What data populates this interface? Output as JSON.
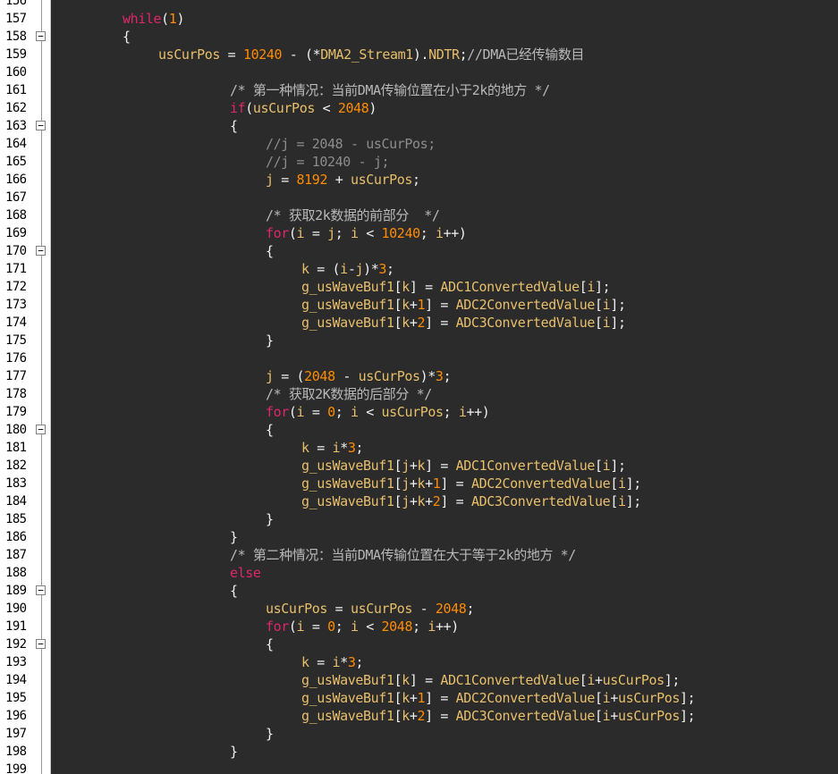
{
  "colors": {
    "background": "#2b2b2b",
    "gutter": "#ffffff",
    "line_number": "#000000",
    "plain": "#e8bf6a",
    "keyword": "#e0266a",
    "number": "#ff8c00",
    "punct": "#f0f0f0",
    "comment": "#b8b8b8",
    "disabled": "#8c8c8c"
  },
  "lines": [
    {
      "num": "156",
      "indent": 0,
      "fold": "line",
      "tokens": []
    },
    {
      "num": "157",
      "indent": 1,
      "fold": "line",
      "tokens": [
        [
          "keyword",
          "while"
        ],
        [
          "punct",
          "("
        ],
        [
          "number",
          "1"
        ],
        [
          "punct",
          ")"
        ]
      ]
    },
    {
      "num": "158",
      "indent": 1,
      "fold": "box",
      "tokens": [
        [
          "punct",
          "{"
        ]
      ]
    },
    {
      "num": "159",
      "indent": 2,
      "fold": "line",
      "tokens": [
        [
          "plain",
          "usCurPos"
        ],
        [
          "punct",
          " = "
        ],
        [
          "number",
          "10240"
        ],
        [
          "punct",
          " - ("
        ],
        [
          "punct",
          "*"
        ],
        [
          "plain",
          "DMA2_Stream1"
        ],
        [
          "punct",
          ")."
        ],
        [
          "plain",
          "NDTR"
        ],
        [
          "punct",
          ";"
        ],
        [
          "comment",
          "//DMA已经传输数目"
        ]
      ]
    },
    {
      "num": "160",
      "indent": 0,
      "fold": "line",
      "tokens": []
    },
    {
      "num": "161",
      "indent": 4,
      "fold": "line",
      "tokens": [
        [
          "comment",
          "/* 第一种情况：当前DMA传输位置在小于2k的地方 */"
        ]
      ]
    },
    {
      "num": "162",
      "indent": 4,
      "fold": "line",
      "tokens": [
        [
          "keyword",
          "if"
        ],
        [
          "punct",
          "("
        ],
        [
          "plain",
          "usCurPos"
        ],
        [
          "punct",
          " < "
        ],
        [
          "number",
          "2048"
        ],
        [
          "punct",
          ")"
        ]
      ]
    },
    {
      "num": "163",
      "indent": 4,
      "fold": "box",
      "tokens": [
        [
          "punct",
          "{"
        ]
      ]
    },
    {
      "num": "164",
      "indent": 5,
      "fold": "line",
      "tokens": [
        [
          "disabled",
          "//j = 2048 - usCurPos;"
        ]
      ]
    },
    {
      "num": "165",
      "indent": 5,
      "fold": "line",
      "tokens": [
        [
          "disabled",
          "//j = 10240 - j;"
        ]
      ]
    },
    {
      "num": "166",
      "indent": 5,
      "fold": "line",
      "tokens": [
        [
          "plain",
          "j"
        ],
        [
          "punct",
          " = "
        ],
        [
          "number",
          "8192"
        ],
        [
          "punct",
          " + "
        ],
        [
          "plain",
          "usCurPos"
        ],
        [
          "punct",
          ";"
        ]
      ]
    },
    {
      "num": "167",
      "indent": 0,
      "fold": "line",
      "tokens": []
    },
    {
      "num": "168",
      "indent": 5,
      "fold": "line",
      "tokens": [
        [
          "comment",
          "/* 获取2k数据的前部分  */"
        ]
      ]
    },
    {
      "num": "169",
      "indent": 5,
      "fold": "line",
      "tokens": [
        [
          "keyword",
          "for"
        ],
        [
          "punct",
          "("
        ],
        [
          "plain",
          "i"
        ],
        [
          "punct",
          " = "
        ],
        [
          "plain",
          "j"
        ],
        [
          "punct",
          "; "
        ],
        [
          "plain",
          "i"
        ],
        [
          "punct",
          " < "
        ],
        [
          "number",
          "10240"
        ],
        [
          "punct",
          "; "
        ],
        [
          "plain",
          "i"
        ],
        [
          "punct",
          "++)"
        ]
      ]
    },
    {
      "num": "170",
      "indent": 5,
      "fold": "box",
      "tokens": [
        [
          "punct",
          "{"
        ]
      ]
    },
    {
      "num": "171",
      "indent": 6,
      "fold": "line",
      "tokens": [
        [
          "plain",
          "k"
        ],
        [
          "punct",
          " = ("
        ],
        [
          "plain",
          "i"
        ],
        [
          "punct",
          "-"
        ],
        [
          "plain",
          "j"
        ],
        [
          "punct",
          ")*"
        ],
        [
          "number",
          "3"
        ],
        [
          "punct",
          ";"
        ]
      ]
    },
    {
      "num": "172",
      "indent": 6,
      "fold": "line",
      "tokens": [
        [
          "plain",
          "g_usWaveBuf1"
        ],
        [
          "punct",
          "["
        ],
        [
          "plain",
          "k"
        ],
        [
          "punct",
          "] = "
        ],
        [
          "plain",
          "ADC1ConvertedValue"
        ],
        [
          "punct",
          "["
        ],
        [
          "plain",
          "i"
        ],
        [
          "punct",
          "];"
        ]
      ]
    },
    {
      "num": "173",
      "indent": 6,
      "fold": "line",
      "tokens": [
        [
          "plain",
          "g_usWaveBuf1"
        ],
        [
          "punct",
          "["
        ],
        [
          "plain",
          "k"
        ],
        [
          "punct",
          "+"
        ],
        [
          "number",
          "1"
        ],
        [
          "punct",
          "] = "
        ],
        [
          "plain",
          "ADC2ConvertedValue"
        ],
        [
          "punct",
          "["
        ],
        [
          "plain",
          "i"
        ],
        [
          "punct",
          "];"
        ]
      ]
    },
    {
      "num": "174",
      "indent": 6,
      "fold": "line",
      "tokens": [
        [
          "plain",
          "g_usWaveBuf1"
        ],
        [
          "punct",
          "["
        ],
        [
          "plain",
          "k"
        ],
        [
          "punct",
          "+"
        ],
        [
          "number",
          "2"
        ],
        [
          "punct",
          "] = "
        ],
        [
          "plain",
          "ADC3ConvertedValue"
        ],
        [
          "punct",
          "["
        ],
        [
          "plain",
          "i"
        ],
        [
          "punct",
          "];"
        ]
      ]
    },
    {
      "num": "175",
      "indent": 5,
      "fold": "line",
      "tokens": [
        [
          "punct",
          "}"
        ]
      ]
    },
    {
      "num": "176",
      "indent": 0,
      "fold": "line",
      "tokens": []
    },
    {
      "num": "177",
      "indent": 5,
      "fold": "line",
      "tokens": [
        [
          "plain",
          "j"
        ],
        [
          "punct",
          " = ("
        ],
        [
          "number",
          "2048"
        ],
        [
          "punct",
          " - "
        ],
        [
          "plain",
          "usCurPos"
        ],
        [
          "punct",
          ")*"
        ],
        [
          "number",
          "3"
        ],
        [
          "punct",
          ";"
        ]
      ]
    },
    {
      "num": "178",
      "indent": 5,
      "fold": "line",
      "tokens": [
        [
          "comment",
          "/* 获取2K数据的后部分 */"
        ]
      ]
    },
    {
      "num": "179",
      "indent": 5,
      "fold": "line",
      "tokens": [
        [
          "keyword",
          "for"
        ],
        [
          "punct",
          "("
        ],
        [
          "plain",
          "i"
        ],
        [
          "punct",
          " = "
        ],
        [
          "number",
          "0"
        ],
        [
          "punct",
          "; "
        ],
        [
          "plain",
          "i"
        ],
        [
          "punct",
          " < "
        ],
        [
          "plain",
          "usCurPos"
        ],
        [
          "punct",
          "; "
        ],
        [
          "plain",
          "i"
        ],
        [
          "punct",
          "++)"
        ]
      ]
    },
    {
      "num": "180",
      "indent": 5,
      "fold": "box",
      "tokens": [
        [
          "punct",
          "{"
        ]
      ]
    },
    {
      "num": "181",
      "indent": 6,
      "fold": "line",
      "tokens": [
        [
          "plain",
          "k"
        ],
        [
          "punct",
          " = "
        ],
        [
          "plain",
          "i"
        ],
        [
          "punct",
          "*"
        ],
        [
          "number",
          "3"
        ],
        [
          "punct",
          ";"
        ]
      ]
    },
    {
      "num": "182",
      "indent": 6,
      "fold": "line",
      "tokens": [
        [
          "plain",
          "g_usWaveBuf1"
        ],
        [
          "punct",
          "["
        ],
        [
          "plain",
          "j"
        ],
        [
          "punct",
          "+"
        ],
        [
          "plain",
          "k"
        ],
        [
          "punct",
          "] = "
        ],
        [
          "plain",
          "ADC1ConvertedValue"
        ],
        [
          "punct",
          "["
        ],
        [
          "plain",
          "i"
        ],
        [
          "punct",
          "];"
        ]
      ]
    },
    {
      "num": "183",
      "indent": 6,
      "fold": "line",
      "tokens": [
        [
          "plain",
          "g_usWaveBuf1"
        ],
        [
          "punct",
          "["
        ],
        [
          "plain",
          "j"
        ],
        [
          "punct",
          "+"
        ],
        [
          "plain",
          "k"
        ],
        [
          "punct",
          "+"
        ],
        [
          "number",
          "1"
        ],
        [
          "punct",
          "] = "
        ],
        [
          "plain",
          "ADC2ConvertedValue"
        ],
        [
          "punct",
          "["
        ],
        [
          "plain",
          "i"
        ],
        [
          "punct",
          "];"
        ]
      ]
    },
    {
      "num": "184",
      "indent": 6,
      "fold": "line",
      "tokens": [
        [
          "plain",
          "g_usWaveBuf1"
        ],
        [
          "punct",
          "["
        ],
        [
          "plain",
          "j"
        ],
        [
          "punct",
          "+"
        ],
        [
          "plain",
          "k"
        ],
        [
          "punct",
          "+"
        ],
        [
          "number",
          "2"
        ],
        [
          "punct",
          "] = "
        ],
        [
          "plain",
          "ADC3ConvertedValue"
        ],
        [
          "punct",
          "["
        ],
        [
          "plain",
          "i"
        ],
        [
          "punct",
          "];"
        ]
      ]
    },
    {
      "num": "185",
      "indent": 5,
      "fold": "line",
      "tokens": [
        [
          "punct",
          "}"
        ]
      ]
    },
    {
      "num": "186",
      "indent": 4,
      "fold": "line",
      "tokens": [
        [
          "punct",
          "}"
        ]
      ]
    },
    {
      "num": "187",
      "indent": 4,
      "fold": "line",
      "tokens": [
        [
          "comment",
          "/* 第二种情况：当前DMA传输位置在大于等于2k的地方 */"
        ]
      ]
    },
    {
      "num": "188",
      "indent": 4,
      "fold": "line",
      "tokens": [
        [
          "keyword",
          "else"
        ]
      ]
    },
    {
      "num": "189",
      "indent": 4,
      "fold": "box",
      "tokens": [
        [
          "punct",
          "{"
        ]
      ]
    },
    {
      "num": "190",
      "indent": 5,
      "fold": "line",
      "tokens": [
        [
          "plain",
          "usCurPos"
        ],
        [
          "punct",
          " = "
        ],
        [
          "plain",
          "usCurPos"
        ],
        [
          "punct",
          " - "
        ],
        [
          "number",
          "2048"
        ],
        [
          "punct",
          ";"
        ]
      ]
    },
    {
      "num": "191",
      "indent": 5,
      "fold": "line",
      "tokens": [
        [
          "keyword",
          "for"
        ],
        [
          "punct",
          "("
        ],
        [
          "plain",
          "i"
        ],
        [
          "punct",
          " = "
        ],
        [
          "number",
          "0"
        ],
        [
          "punct",
          "; "
        ],
        [
          "plain",
          "i"
        ],
        [
          "punct",
          " < "
        ],
        [
          "number",
          "2048"
        ],
        [
          "punct",
          "; "
        ],
        [
          "plain",
          "i"
        ],
        [
          "punct",
          "++)"
        ]
      ]
    },
    {
      "num": "192",
      "indent": 5,
      "fold": "box",
      "tokens": [
        [
          "punct",
          "{"
        ]
      ]
    },
    {
      "num": "193",
      "indent": 6,
      "fold": "line",
      "tokens": [
        [
          "plain",
          "k"
        ],
        [
          "punct",
          " = "
        ],
        [
          "plain",
          "i"
        ],
        [
          "punct",
          "*"
        ],
        [
          "number",
          "3"
        ],
        [
          "punct",
          ";"
        ]
      ]
    },
    {
      "num": "194",
      "indent": 6,
      "fold": "line",
      "tokens": [
        [
          "plain",
          "g_usWaveBuf1"
        ],
        [
          "punct",
          "["
        ],
        [
          "plain",
          "k"
        ],
        [
          "punct",
          "] = "
        ],
        [
          "plain",
          "ADC1ConvertedValue"
        ],
        [
          "punct",
          "["
        ],
        [
          "plain",
          "i"
        ],
        [
          "punct",
          "+"
        ],
        [
          "plain",
          "usCurPos"
        ],
        [
          "punct",
          "];"
        ]
      ]
    },
    {
      "num": "195",
      "indent": 6,
      "fold": "line",
      "tokens": [
        [
          "plain",
          "g_usWaveBuf1"
        ],
        [
          "punct",
          "["
        ],
        [
          "plain",
          "k"
        ],
        [
          "punct",
          "+"
        ],
        [
          "number",
          "1"
        ],
        [
          "punct",
          "] = "
        ],
        [
          "plain",
          "ADC2ConvertedValue"
        ],
        [
          "punct",
          "["
        ],
        [
          "plain",
          "i"
        ],
        [
          "punct",
          "+"
        ],
        [
          "plain",
          "usCurPos"
        ],
        [
          "punct",
          "];"
        ]
      ]
    },
    {
      "num": "196",
      "indent": 6,
      "fold": "line",
      "tokens": [
        [
          "plain",
          "g_usWaveBuf1"
        ],
        [
          "punct",
          "["
        ],
        [
          "plain",
          "k"
        ],
        [
          "punct",
          "+"
        ],
        [
          "number",
          "2"
        ],
        [
          "punct",
          "] = "
        ],
        [
          "plain",
          "ADC3ConvertedValue"
        ],
        [
          "punct",
          "["
        ],
        [
          "plain",
          "i"
        ],
        [
          "punct",
          "+"
        ],
        [
          "plain",
          "usCurPos"
        ],
        [
          "punct",
          "];"
        ]
      ]
    },
    {
      "num": "197",
      "indent": 5,
      "fold": "line",
      "tokens": [
        [
          "punct",
          "}"
        ]
      ]
    },
    {
      "num": "198",
      "indent": 4,
      "fold": "line",
      "tokens": [
        [
          "punct",
          "}"
        ]
      ]
    },
    {
      "num": "199",
      "indent": 0,
      "fold": "line",
      "tokens": []
    }
  ]
}
